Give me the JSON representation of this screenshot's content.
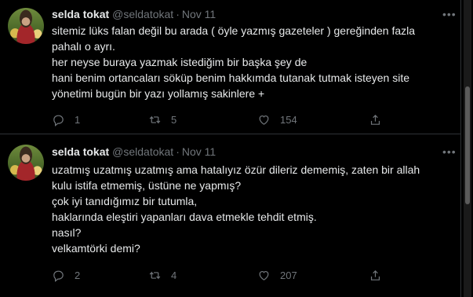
{
  "tweets": [
    {
      "name": "selda tokat",
      "handle": "@seldatokat",
      "separator": "·",
      "date": "Nov 11",
      "lines": [
        "sitemiz lüks falan değil bu arada ( öyle yazmış gazeteler ) gereğinden fazla",
        "pahalı o ayrı.",
        "her neyse buraya yazmak istediğim bir başka şey de",
        "hani benim ortancaları söküp benim hakkımda tutanak tutmak isteyen site",
        "yönetimi bugün bir yazı yollamış sakinlere +"
      ],
      "replies": "1",
      "retweets": "5",
      "likes": "154"
    },
    {
      "name": "selda tokat",
      "handle": "@seldatokat",
      "separator": "·",
      "date": "Nov 11",
      "lines": [
        "uzatmış uzatmış uzatmış ama hatalıyız özür dileriz dememiş, zaten bir allah",
        "kulu istifa etmemiş, üstüne ne yapmış?",
        "çok iyi tanıdığımız bir tutumla,",
        "haklarında eleştiri yapanları dava etmekle tehdit etmiş.",
        "nasıl?",
        "velkamtörki demi?"
      ],
      "replies": "2",
      "retweets": "4",
      "likes": "207"
    }
  ],
  "icons": {
    "more": "more-icon",
    "reply": "reply-icon",
    "retweet": "retweet-icon",
    "like": "heart-icon",
    "share": "share-icon"
  },
  "colors": {
    "background": "#000000",
    "text": "#e7e9ea",
    "muted": "#71767b",
    "divider": "#2f3336"
  }
}
